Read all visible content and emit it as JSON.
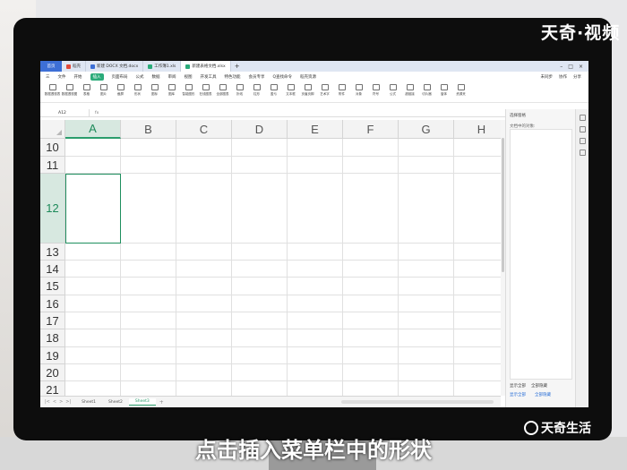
{
  "watermark_top": "天奇·视频",
  "caption": "点击插入菜单栏中的形状",
  "logo": "天奇生活",
  "tabs": [
    {
      "label": "首页",
      "icon": "home-tab"
    },
    {
      "label": "稻壳",
      "icon": "docer-icon",
      "color": "#e04a3a"
    },
    {
      "label": "新建 DOCX 文档.docx",
      "icon": "word-icon",
      "color": "#3d6fd6"
    },
    {
      "label": "工作簿1.xls",
      "icon": "excel-icon",
      "color": "#2bab7a"
    },
    {
      "label": "新建表格文档.xlsx",
      "icon": "excel-icon",
      "color": "#2bab7a",
      "active": true
    }
  ],
  "menu": {
    "items": [
      "三",
      "文件",
      "开始",
      "插入",
      "页面布局",
      "公式",
      "数据",
      "审阅",
      "视图",
      "开发工具",
      "特色功能",
      "会员专享",
      "Q查找命令",
      "稻壳资源"
    ],
    "active": "插入",
    "right": [
      "未同步",
      "协作",
      "分享"
    ]
  },
  "ribbon": [
    "数据透视表",
    "数据透视图",
    "表格",
    "图片",
    "截屏",
    "形状",
    "图标",
    "图库",
    "智能图形",
    "在线图表",
    "全部图表",
    "折线",
    "柱形",
    "盈亏",
    "文本框",
    "页眉页脚",
    "艺术字",
    "附件",
    "对象",
    "符号",
    "公式",
    "超链接",
    "切片器",
    "窗体",
    "资源夹"
  ],
  "formula": {
    "namebox": "A12",
    "fx": "fx"
  },
  "columns": [
    "A",
    "B",
    "C",
    "D",
    "E",
    "F",
    "G",
    "H"
  ],
  "rows": [
    "10",
    "11",
    "12",
    "13",
    "14",
    "15",
    "16",
    "17",
    "18",
    "19",
    "20",
    "21"
  ],
  "selected": {
    "column": "A",
    "row": "12"
  },
  "sheets": [
    "Sheet1",
    "Sheet2",
    "Sheet3"
  ],
  "active_sheet": "Sheet3",
  "sidepanel": {
    "title": "选择窗格",
    "subtitle": "文档中的对象:",
    "bottom_row1": [
      "显示全部",
      "全部隐藏"
    ],
    "bottom_row2": [
      "显示全部",
      "全部隐藏"
    ]
  },
  "colors": {
    "accent": "#2a9d6c",
    "tab_blue": "#3d6fd6"
  }
}
